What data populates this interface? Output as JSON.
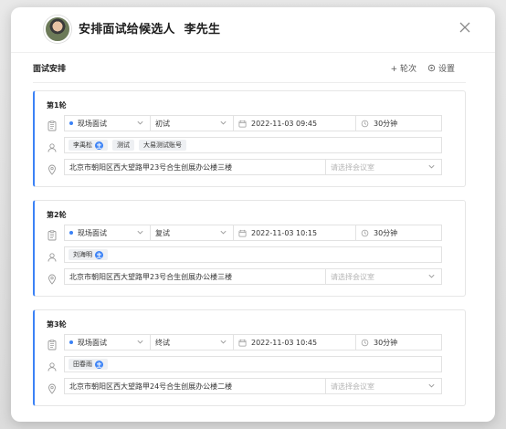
{
  "dialog": {
    "title": "安排面试给候选人",
    "candidate": "李先生"
  },
  "section": {
    "title": "面试安排",
    "add_round_label": "+ 轮次",
    "settings_label": "设置"
  },
  "rounds": [
    {
      "title": "第1轮",
      "type": "现场面试",
      "stage": "初试",
      "datetime": "2022-11-03 09:45",
      "duration": "30分钟",
      "interviewers": [
        {
          "name": "李禹松",
          "lead": true,
          "lead_mark": "主"
        },
        {
          "name": "测试",
          "lead": false
        },
        {
          "name": "大易测试账号",
          "lead": false
        }
      ],
      "address": "北京市朝阳区西大望路甲23号合生创展办公楼三楼",
      "room_placeholder": "请选择会议室"
    },
    {
      "title": "第2轮",
      "type": "现场面试",
      "stage": "复试",
      "datetime": "2022-11-03 10:15",
      "duration": "30分钟",
      "interviewers": [
        {
          "name": "刘海明",
          "lead": true,
          "lead_mark": "主"
        }
      ],
      "address": "北京市朝阳区西大望路甲23号合生创展办公楼三楼",
      "room_placeholder": "请选择会议室"
    },
    {
      "title": "第3轮",
      "type": "现场面试",
      "stage": "终试",
      "datetime": "2022-11-03 10:45",
      "duration": "30分钟",
      "interviewers": [
        {
          "name": "田春雨",
          "lead": true,
          "lead_mark": "主"
        }
      ],
      "address": "北京市朝阳区西大望路甲24号合生创展办公楼二楼",
      "room_placeholder": "请选择会议室"
    }
  ],
  "colors": {
    "accent": "#3b82f6",
    "border": "#e2e2e2",
    "placeholder": "#b5b5b5"
  },
  "icons": {
    "close": "close-icon",
    "settings": "gear-icon",
    "type_row": "calendar-list-icon",
    "people_row": "user-icon",
    "location_row": "location-pin-icon",
    "date": "calendar-icon",
    "duration": "clock-icon",
    "dropdown": "chevron-down-icon"
  }
}
